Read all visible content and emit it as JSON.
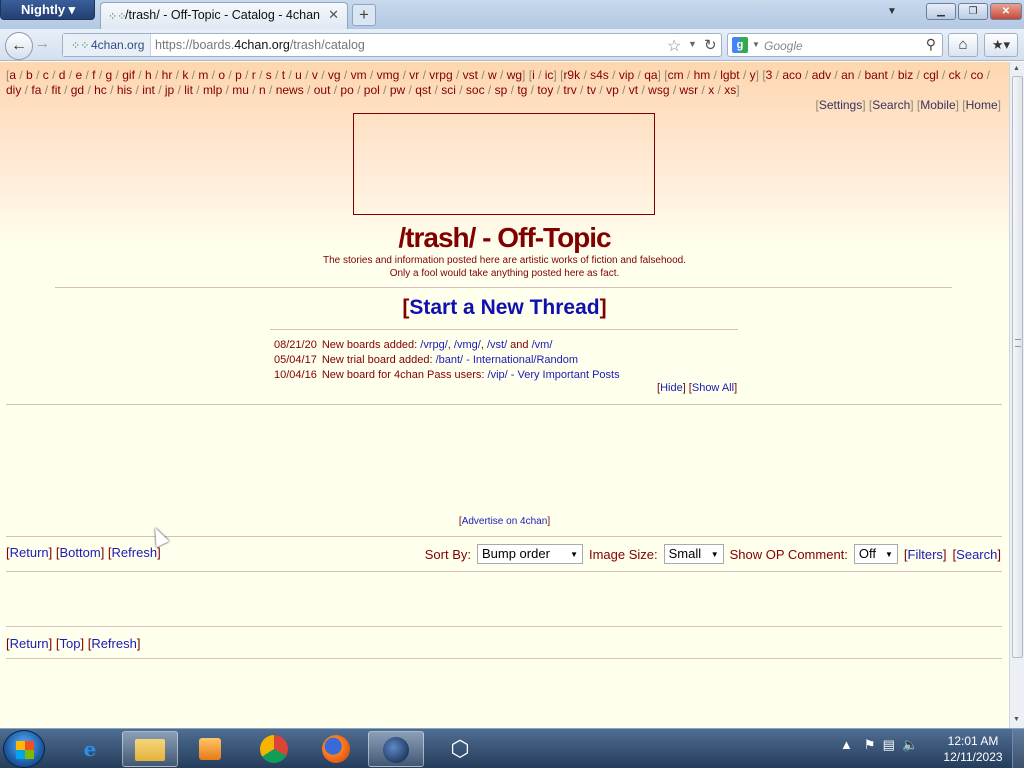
{
  "browser": {
    "app_menu": "Nightly",
    "tab_title": "/trash/ - Off-Topic - Catalog - 4chan",
    "identity": "4chan.org",
    "url_prefix": "https://boards.",
    "url_domain": "4chan.org",
    "url_path": "/trash/catalog",
    "search_placeholder": "Google"
  },
  "boardlist": {
    "groups": [
      [
        "a",
        "b",
        "c",
        "d",
        "e",
        "f",
        "g",
        "gif",
        "h",
        "hr",
        "k",
        "m",
        "o",
        "p",
        "r",
        "s",
        "t",
        "u",
        "v",
        "vg",
        "vm",
        "vmg",
        "vr",
        "vrpg",
        "vst",
        "w",
        "wg"
      ],
      [
        "i",
        "ic"
      ],
      [
        "r9k",
        "s4s",
        "vip",
        "qa"
      ],
      [
        "cm",
        "hm",
        "lgbt",
        "y"
      ],
      [
        "3",
        "aco",
        "adv",
        "an",
        "bant",
        "biz",
        "cgl",
        "ck",
        "co",
        "diy",
        "fa",
        "fit",
        "gd",
        "hc",
        "his",
        "int",
        "jp",
        "lit",
        "mlp",
        "mu",
        "n",
        "news",
        "out",
        "po",
        "pol",
        "pw",
        "qst",
        "sci",
        "soc",
        "sp",
        "tg",
        "toy",
        "trv",
        "tv",
        "vp",
        "vt",
        "wsg",
        "wsr",
        "x",
        "xs"
      ]
    ],
    "top_links": [
      "Settings",
      "Search",
      "Mobile",
      "Home"
    ]
  },
  "board": {
    "title": "/trash/ - Off-Topic",
    "subtitle_1": "The stories and information posted here are artistic works of fiction and falsehood.",
    "subtitle_2": "Only a fool would take anything posted here as fact.",
    "new_thread": "Start a New Thread"
  },
  "news": [
    {
      "date": "08/21/20",
      "text": "New boards added:",
      "links": [
        "/vrpg/",
        ", ",
        "/vmg/",
        ", ",
        "/vst/",
        " and ",
        "/vm/"
      ]
    },
    {
      "date": "05/04/17",
      "text": "New trial board added:",
      "links": [
        "/bant/ - International/Random"
      ]
    },
    {
      "date": "10/04/16",
      "text": "New board for 4chan Pass users:",
      "links": [
        "/vip/ - Very Important Posts"
      ]
    }
  ],
  "news_controls": {
    "hide": "Hide",
    "show_all": "Show All"
  },
  "advertise": "Advertise on 4chan",
  "nav_top": {
    "return": "Return",
    "bottom": "Bottom",
    "refresh": "Refresh"
  },
  "nav_bottom": {
    "return": "Return",
    "top": "Top",
    "refresh": "Refresh"
  },
  "catalog_controls": {
    "sort_label": "Sort By:",
    "sort_value": "Bump order",
    "size_label": "Image Size:",
    "size_value": "Small",
    "op_label": "Show OP Comment:",
    "op_value": "Off",
    "filters": "Filters",
    "search": "Search"
  },
  "taskbar": {
    "time": "12:01 AM",
    "date": "12/11/2023"
  }
}
